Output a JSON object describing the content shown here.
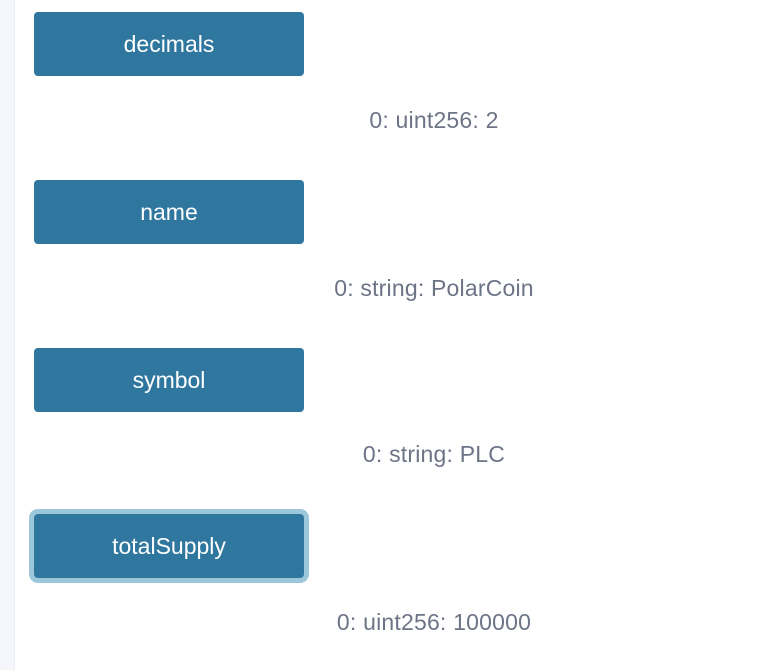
{
  "functions": [
    {
      "label": "decimals",
      "result": "0: uint256: 2"
    },
    {
      "label": "name",
      "result": "0: string: PolarCoin"
    },
    {
      "label": "symbol",
      "result": "0: string: PLC"
    },
    {
      "label": "totalSupply",
      "result": "0: uint256: 100000"
    }
  ]
}
